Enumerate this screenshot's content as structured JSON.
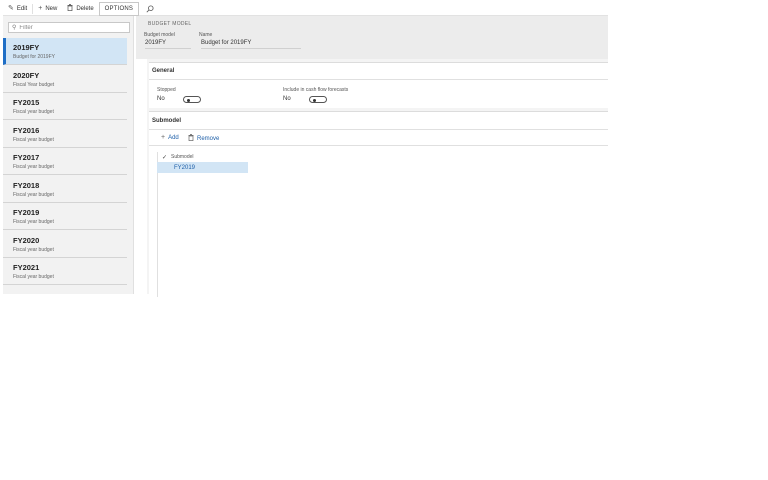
{
  "toolbar": {
    "edit_label": "Edit",
    "new_label": "New",
    "delete_label": "Delete",
    "options_label": "OPTIONS"
  },
  "filter": {
    "placeholder": "Filter"
  },
  "list": {
    "items": [
      {
        "title": "2019FY",
        "subtitle": "Budget for 2019FY"
      },
      {
        "title": "2020FY",
        "subtitle": "Fiscal Year budget"
      },
      {
        "title": "FY2015",
        "subtitle": "Fiscal year budget"
      },
      {
        "title": "FY2016",
        "subtitle": "Fiscal year budget"
      },
      {
        "title": "FY2017",
        "subtitle": "Fiscal year budget"
      },
      {
        "title": "FY2018",
        "subtitle": "Fiscal year budget"
      },
      {
        "title": "FY2019",
        "subtitle": "Fiscal year budget"
      },
      {
        "title": "FY2020",
        "subtitle": "Fiscal year budget"
      },
      {
        "title": "FY2021",
        "subtitle": "Fiscal year budget"
      }
    ],
    "selected_index": 0
  },
  "header": {
    "caption": "BUDGET MODEL",
    "budget_model_label": "Budget model",
    "budget_model_value": "2019FY",
    "name_label": "Name",
    "name_value": "Budget for 2019FY"
  },
  "general": {
    "title": "General",
    "stopped_label": "Stopped",
    "stopped_value": "No",
    "cashflow_label": "Include in cash flow forecasts",
    "cashflow_value": "No"
  },
  "submodel": {
    "title": "Submodel",
    "add_label": "Add",
    "remove_label": "Remove",
    "column_header": "Submodel",
    "rows": [
      "FY2019"
    ]
  },
  "colors": {
    "accent": "#1e6ec6",
    "selected_bg": "#d2e5f5",
    "link": "#1e5fa8",
    "pane_bg": "#f2f2f2"
  },
  "icons": {
    "edit": "pencil-icon",
    "new": "plus-icon",
    "delete": "trash-icon",
    "search": "search-icon",
    "filter": "search-icon",
    "check": "checkmark-icon"
  }
}
